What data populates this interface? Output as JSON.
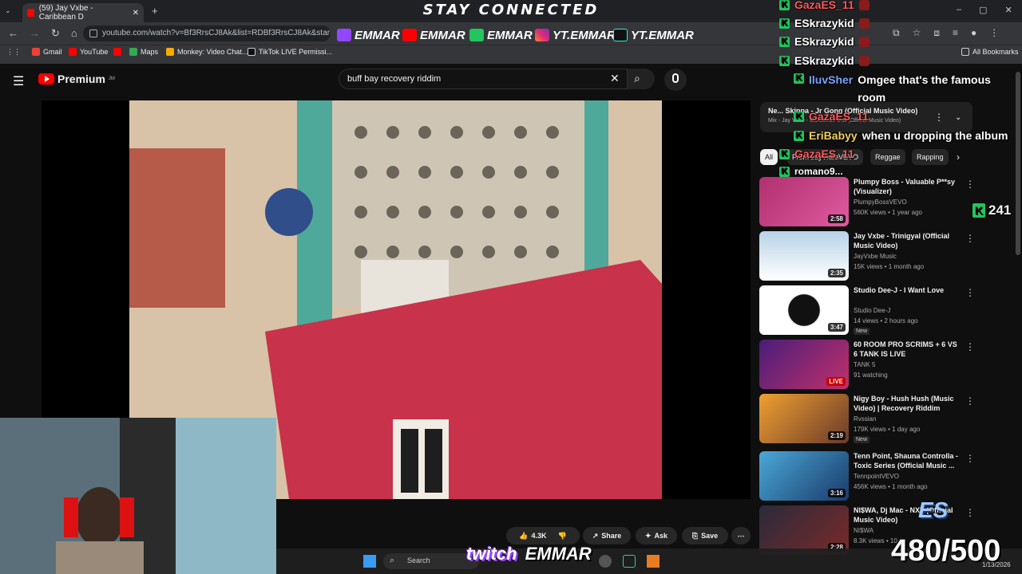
{
  "browser": {
    "tab_title": "(59) Jay Vxbe - Caribbean D",
    "url": "youtube.com/watch?v=Bf3RrsCJ8Ak&list=RDBf3RrsCJ8Ak&start_radio=",
    "bookmarks": [
      "Gmail",
      "YouTube",
      "Maps",
      "Monkey: Video Chat...",
      "TikTok LIVE Permissi..."
    ],
    "all_bookmarks": "All Bookmarks"
  },
  "stream": {
    "banner": "STAY CONNECTED",
    "socials": [
      "EMMAR",
      "EMMAR",
      "EMMAR",
      "YT.EMMAR",
      "YT.EMMAR"
    ],
    "twitch_label": "twitch",
    "twitch_name": "EMMAR",
    "counter": "480/500",
    "viewer_count": "241"
  },
  "youtube": {
    "logo": "Premium",
    "logo_sup": "JM",
    "search_value": "buff bay recovery riddim",
    "mini_player": {
      "title": "Ne... Skippa - Jr Gong (Official Music Video)",
      "subtitle": "Mix - Jay Vxbe - Caribbean Doll (Official Music Video)"
    },
    "chips": [
      "All",
      "From JayVxbeVEVO",
      "Reggae",
      "Rapping"
    ],
    "actions": {
      "likes": "4.3K",
      "share": "Share",
      "ask": "Ask",
      "save": "Save"
    },
    "recommendations": [
      {
        "title": "Plumpy Boss - Valuable P**sy (Visualizer)",
        "channel": "PlumpyBossVEVO",
        "meta": "560K views • 1 year ago",
        "duration": "2:58",
        "new": ""
      },
      {
        "title": "Jay Vxbe - Trinigyal (Official Music Video)",
        "channel": "JayVxbe Music",
        "meta": "15K views • 1 month ago",
        "duration": "2:35",
        "new": ""
      },
      {
        "title": "Studio Dee-J - I Want Love",
        "channel": "Studio Dee-J",
        "meta": "14 views • 2 hours ago",
        "duration": "3:47",
        "new": "New"
      },
      {
        "title": "60 ROOM PRO SCRIMS + 6 VS 6 TANK IS LIVE",
        "channel": "TANK 5",
        "meta": "91 watching",
        "duration": "LIVE",
        "new": ""
      },
      {
        "title": "Nigy Boy - Hush Hush (Music Video) | Recovery Riddim",
        "channel": "Rvssian",
        "meta": "179K views • 1 day ago",
        "duration": "2:19",
        "new": "New"
      },
      {
        "title": "Tenn Point, Shauna Controlla - Toxic Series (Official Music ...",
        "channel": "TennpointVEVO",
        "meta": "456K views • 1 month ago",
        "duration": "3:16",
        "new": ""
      },
      {
        "title": "NI$WA, Dj Mac - NXT (Official Music Video)",
        "channel": "NI$WA",
        "meta": "8.3K views • 10 ...",
        "duration": "2:28",
        "new": ""
      }
    ]
  },
  "chat": [
    {
      "user": "GazaES_11",
      "msg": ""
    },
    {
      "user": "ESkrazykid",
      "msg": ""
    },
    {
      "user": "ESkrazykid",
      "msg": ""
    },
    {
      "user": "ESkrazykid",
      "msg": ""
    },
    {
      "user": "IluvSher",
      "msg": "Omgee that's the famous room"
    },
    {
      "user": "GazaES_11",
      "msg": ""
    },
    {
      "user": "EriBabyy",
      "msg": "when u dropping the album"
    },
    {
      "user": "GazaES_11",
      "msg": ""
    },
    {
      "user": "romano9...",
      "msg": ""
    }
  ],
  "taskbar": {
    "search": "Search",
    "date": "1/13/2026"
  },
  "colors": {
    "kick": "#22c55e",
    "youtube_red": "#ff0000",
    "twitch": "#9146ff"
  }
}
